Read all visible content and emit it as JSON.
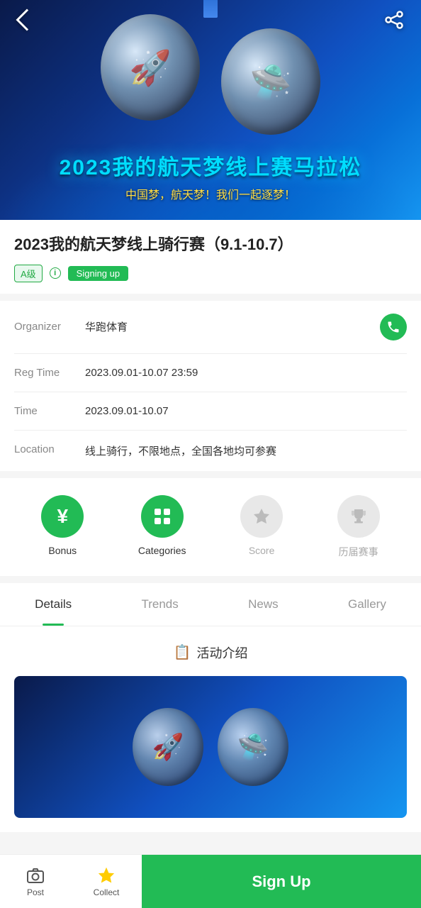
{
  "hero": {
    "title_cn": "2023我的航天梦线上赛马拉松",
    "subtitle": "中国梦，航天梦！我们一起逐梦！"
  },
  "event": {
    "title": "2023我的航天梦线上骑行赛（9.1-10.7）",
    "badge_level": "A级",
    "badge_status": "Signing up",
    "organizer_label": "Organizer",
    "organizer_value": "华跑体育",
    "reg_time_label": "Reg Time",
    "reg_time_value": "2023.09.01-10.07 23:59",
    "time_label": "Time",
    "time_value": "2023.09.01-10.07",
    "location_label": "Location",
    "location_value": "线上骑行，不限地点，全国各地均可参赛"
  },
  "icons": [
    {
      "label": "Bonus",
      "type": "green",
      "symbol": "¥"
    },
    {
      "label": "Categories",
      "type": "green",
      "symbol": "⊞"
    },
    {
      "label": "Score",
      "type": "gray",
      "symbol": "⭐"
    },
    {
      "label": "历届赛事",
      "type": "gray",
      "symbol": "🏆"
    }
  ],
  "tabs": [
    {
      "label": "Details",
      "active": true
    },
    {
      "label": "Trends",
      "active": false
    },
    {
      "label": "News",
      "active": false
    },
    {
      "label": "Gallery",
      "active": false
    }
  ],
  "content": {
    "section_title": "活动介绍",
    "section_icon": "📋"
  },
  "bottom": {
    "post_label": "Post",
    "collect_label": "Collect",
    "signup_label": "Sign Up"
  }
}
